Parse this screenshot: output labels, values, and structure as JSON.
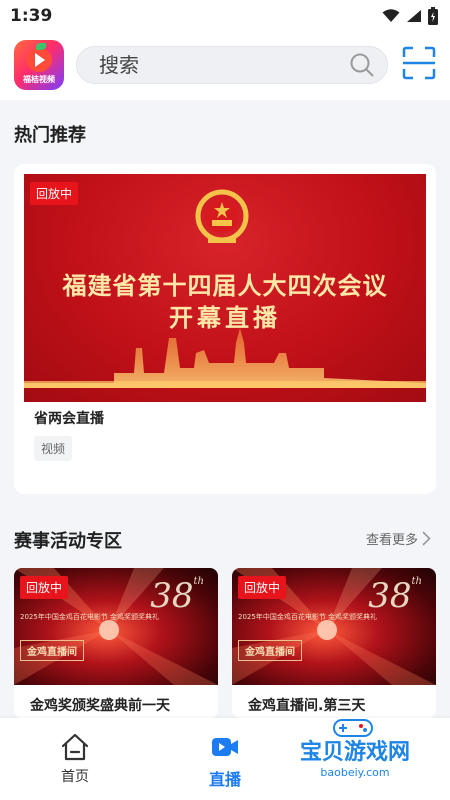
{
  "status_bar": {
    "time": "1:39"
  },
  "header": {
    "logo_text": "福桔视频",
    "search_placeholder": "搜索"
  },
  "hot": {
    "section_title": "热门推荐",
    "badge": "回放中",
    "banner_line1": "福建省第十四届人大四次会议",
    "banner_line2": "开幕直播",
    "title": "省两会直播",
    "tag": "视频"
  },
  "events": {
    "section_title": "赛事活动专区",
    "see_more": "查看更多",
    "items": [
      {
        "badge": "回放中",
        "number": "38",
        "suffix": "th",
        "subtitle": "2025年中国金鸡百花电影节 金鸡奖颁奖典礼",
        "name_box": "金鸡直播间",
        "title": "金鸡奖颁奖盛典前一天"
      },
      {
        "badge": "回放中",
        "number": "38",
        "suffix": "th",
        "subtitle": "2025年中国金鸡百花电影节 金鸡奖颁奖典礼",
        "name_box": "金鸡直播间",
        "title": "金鸡直播间.第三天"
      }
    ]
  },
  "bottom_nav": {
    "items": [
      {
        "label": "首页",
        "icon": "home-icon",
        "active": false
      },
      {
        "label": "直播",
        "icon": "live-icon",
        "active": true
      }
    ],
    "accent_color": "#1e7cf2"
  },
  "watermark": {
    "text": "宝贝游戏网",
    "url": "baobeiy.com"
  }
}
